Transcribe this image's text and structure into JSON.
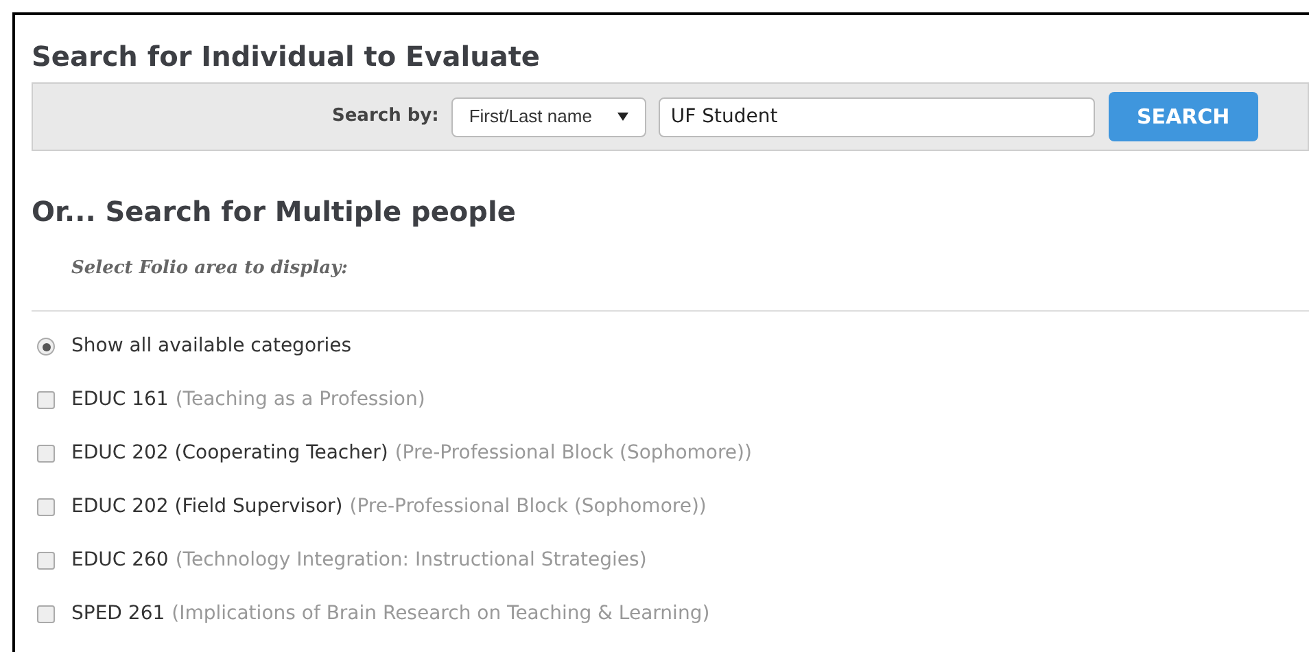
{
  "title": "Search for Individual to Evaluate",
  "search": {
    "label": "Search by:",
    "select": "First/Last name",
    "value": "UF Student",
    "button": "SEARCH"
  },
  "multi_title": "Or... Search for Multiple people",
  "subtitle": "Select Folio area to display:",
  "options": [
    {
      "kind": "radio",
      "label": "Show all available categories",
      "selected": true
    },
    {
      "kind": "checkbox",
      "label": "EDUC 161",
      "detail": "(Teaching as a Profession)",
      "checked": false
    },
    {
      "kind": "checkbox",
      "label": "EDUC 202 (Cooperating Teacher)",
      "detail": "(Pre-Professional Block (Sophomore))",
      "checked": false
    },
    {
      "kind": "checkbox",
      "label": "EDUC 202 (Field Supervisor)",
      "detail": "(Pre-Professional Block (Sophomore))",
      "checked": false
    },
    {
      "kind": "checkbox",
      "label": "EDUC 260",
      "detail": "(Technology Integration: Instructional Strategies)",
      "checked": false
    },
    {
      "kind": "checkbox",
      "label": "SPED 261",
      "detail": "(Implications of Brain Research on Teaching & Learning)",
      "checked": false
    }
  ]
}
